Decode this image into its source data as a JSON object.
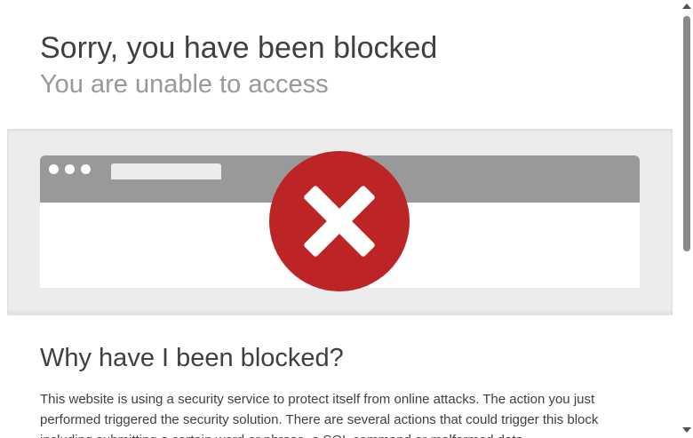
{
  "header": {
    "title": "Sorry, you have been blocked",
    "subtitle": "You are unable to access"
  },
  "hero": {
    "icon": "blocked-x-icon",
    "icon_color": "#bd2426",
    "frame_color": "#999999"
  },
  "section": {
    "heading": "Why have I been blocked?",
    "body": "This website is using a security service to protect itself from online attacks. The action you just performed triggered the security solution. There are several actions that could trigger this block including submitting a certain word or phrase, a SQL command or malformed data."
  },
  "colors": {
    "text": "#404040",
    "subtitle": "#999999",
    "hero_bg": "#ececec"
  }
}
